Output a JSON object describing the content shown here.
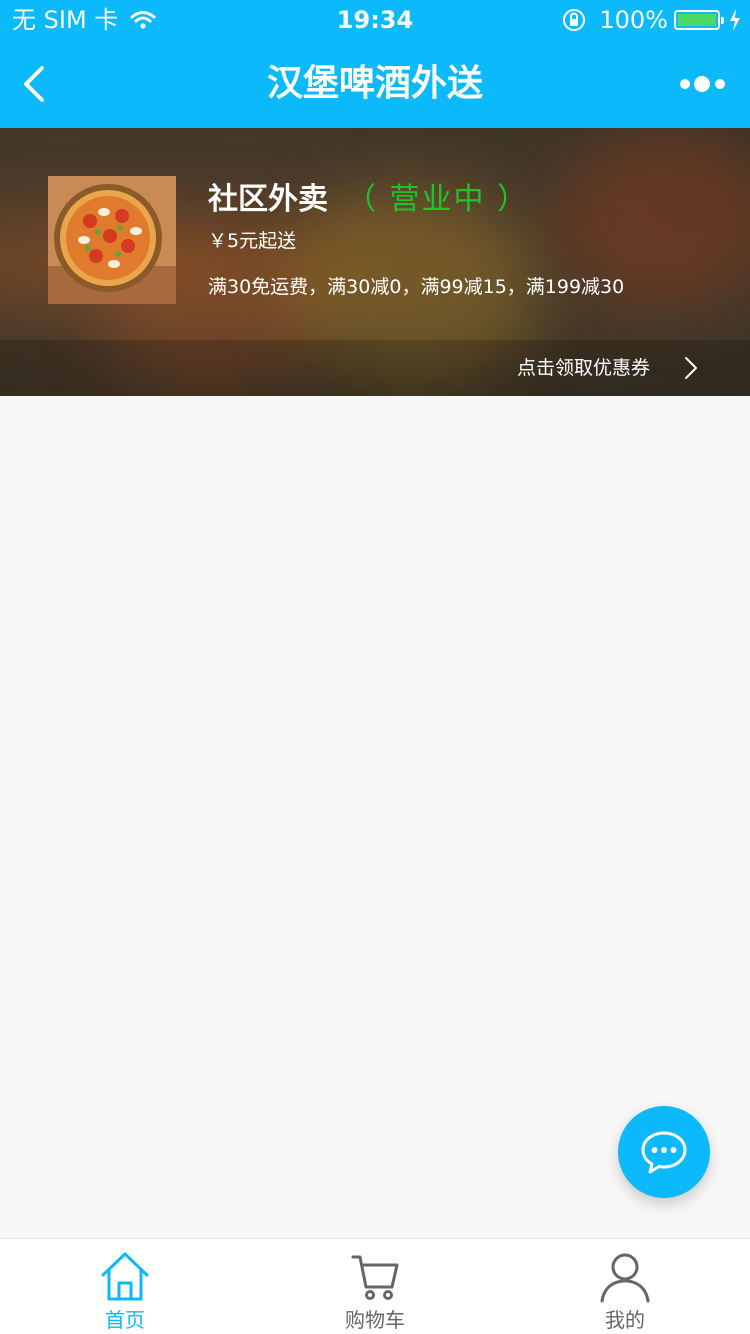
{
  "status_bar": {
    "carrier": "无 SIM 卡",
    "time": "19:34",
    "battery": "100%"
  },
  "nav": {
    "title": "汉堡啤酒外送",
    "back_icon": "chevron-left-icon",
    "more_icon": "more-dots-icon"
  },
  "shop": {
    "name": "社区外卖",
    "status": "（ 营业中 ）",
    "min_order": "￥5元起送",
    "promotions": "满30免运费，满30减0，满99减15，满199减30",
    "coupon_link": "点击领取优惠券"
  },
  "tabs": [
    {
      "label": "首页",
      "icon": "home-icon",
      "active": true
    },
    {
      "label": "购物车",
      "icon": "cart-icon",
      "active": false
    },
    {
      "label": "我的",
      "icon": "user-icon",
      "active": false
    }
  ],
  "colors": {
    "brand": "#0cb9fb",
    "status_green": "#1ec42c",
    "background": "#f7f7f7"
  }
}
